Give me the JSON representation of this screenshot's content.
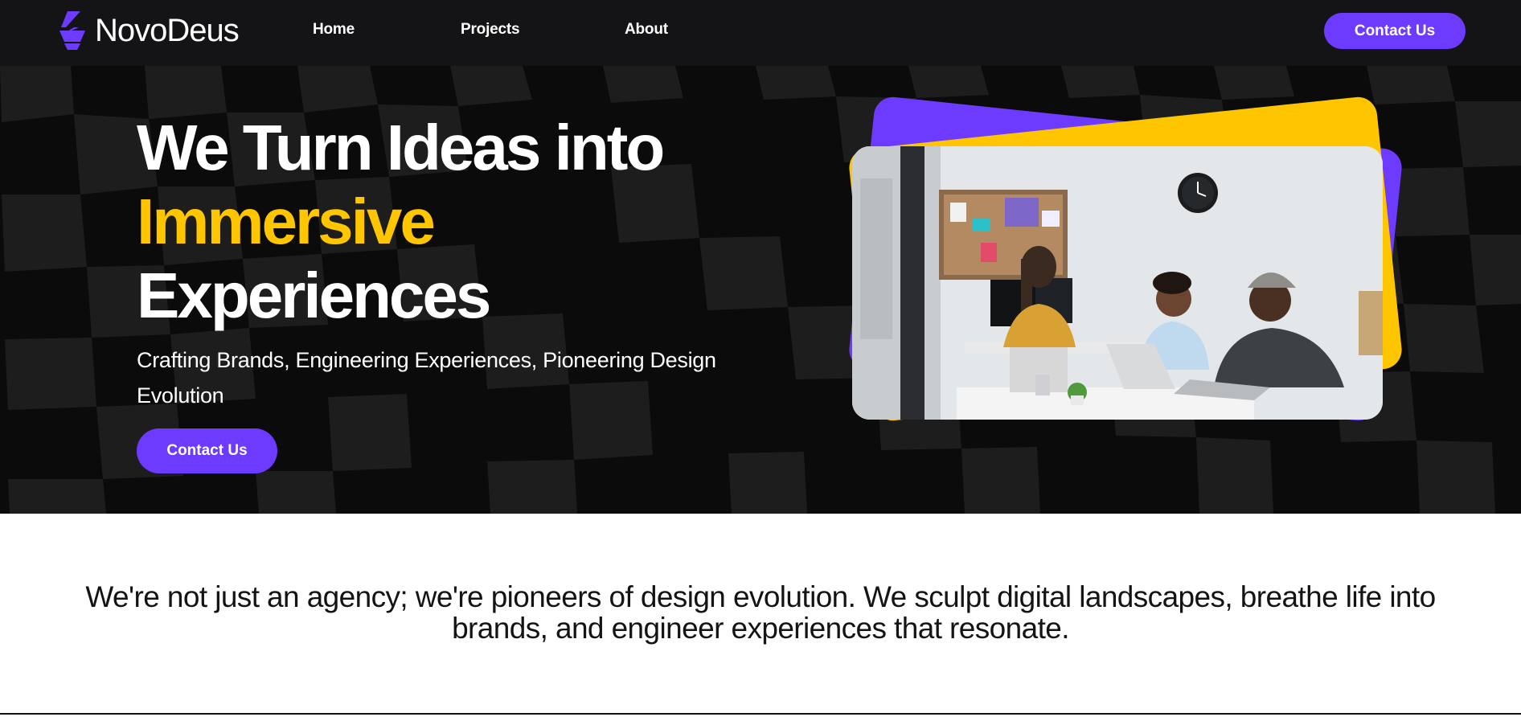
{
  "colors": {
    "brand_purple": "#6c3bff",
    "accent_yellow": "#ffc600",
    "nav_background": "#141416",
    "hero_background": "#0c0c0c"
  },
  "nav": {
    "logo_text": "NovoDeus",
    "logo_icon": "novodeus-logo-icon",
    "links": [
      "Home",
      "Projects",
      "About"
    ],
    "cta_label": "Contact Us"
  },
  "hero": {
    "title_line1": "We Turn Ideas into",
    "title_accent": "Immersive",
    "title_line3": "Experiences",
    "subtitle": "Crafting Brands, Engineering Experiences, Pioneering Design Evolution",
    "cta_label": "Contact Us",
    "image_alt": "Team collaborating in an office"
  },
  "statement": {
    "text": "We're not just an agency; we're pioneers of design evolution. We sculpt digital landscapes, breathe life into brands, and engineer experiences that resonate."
  }
}
